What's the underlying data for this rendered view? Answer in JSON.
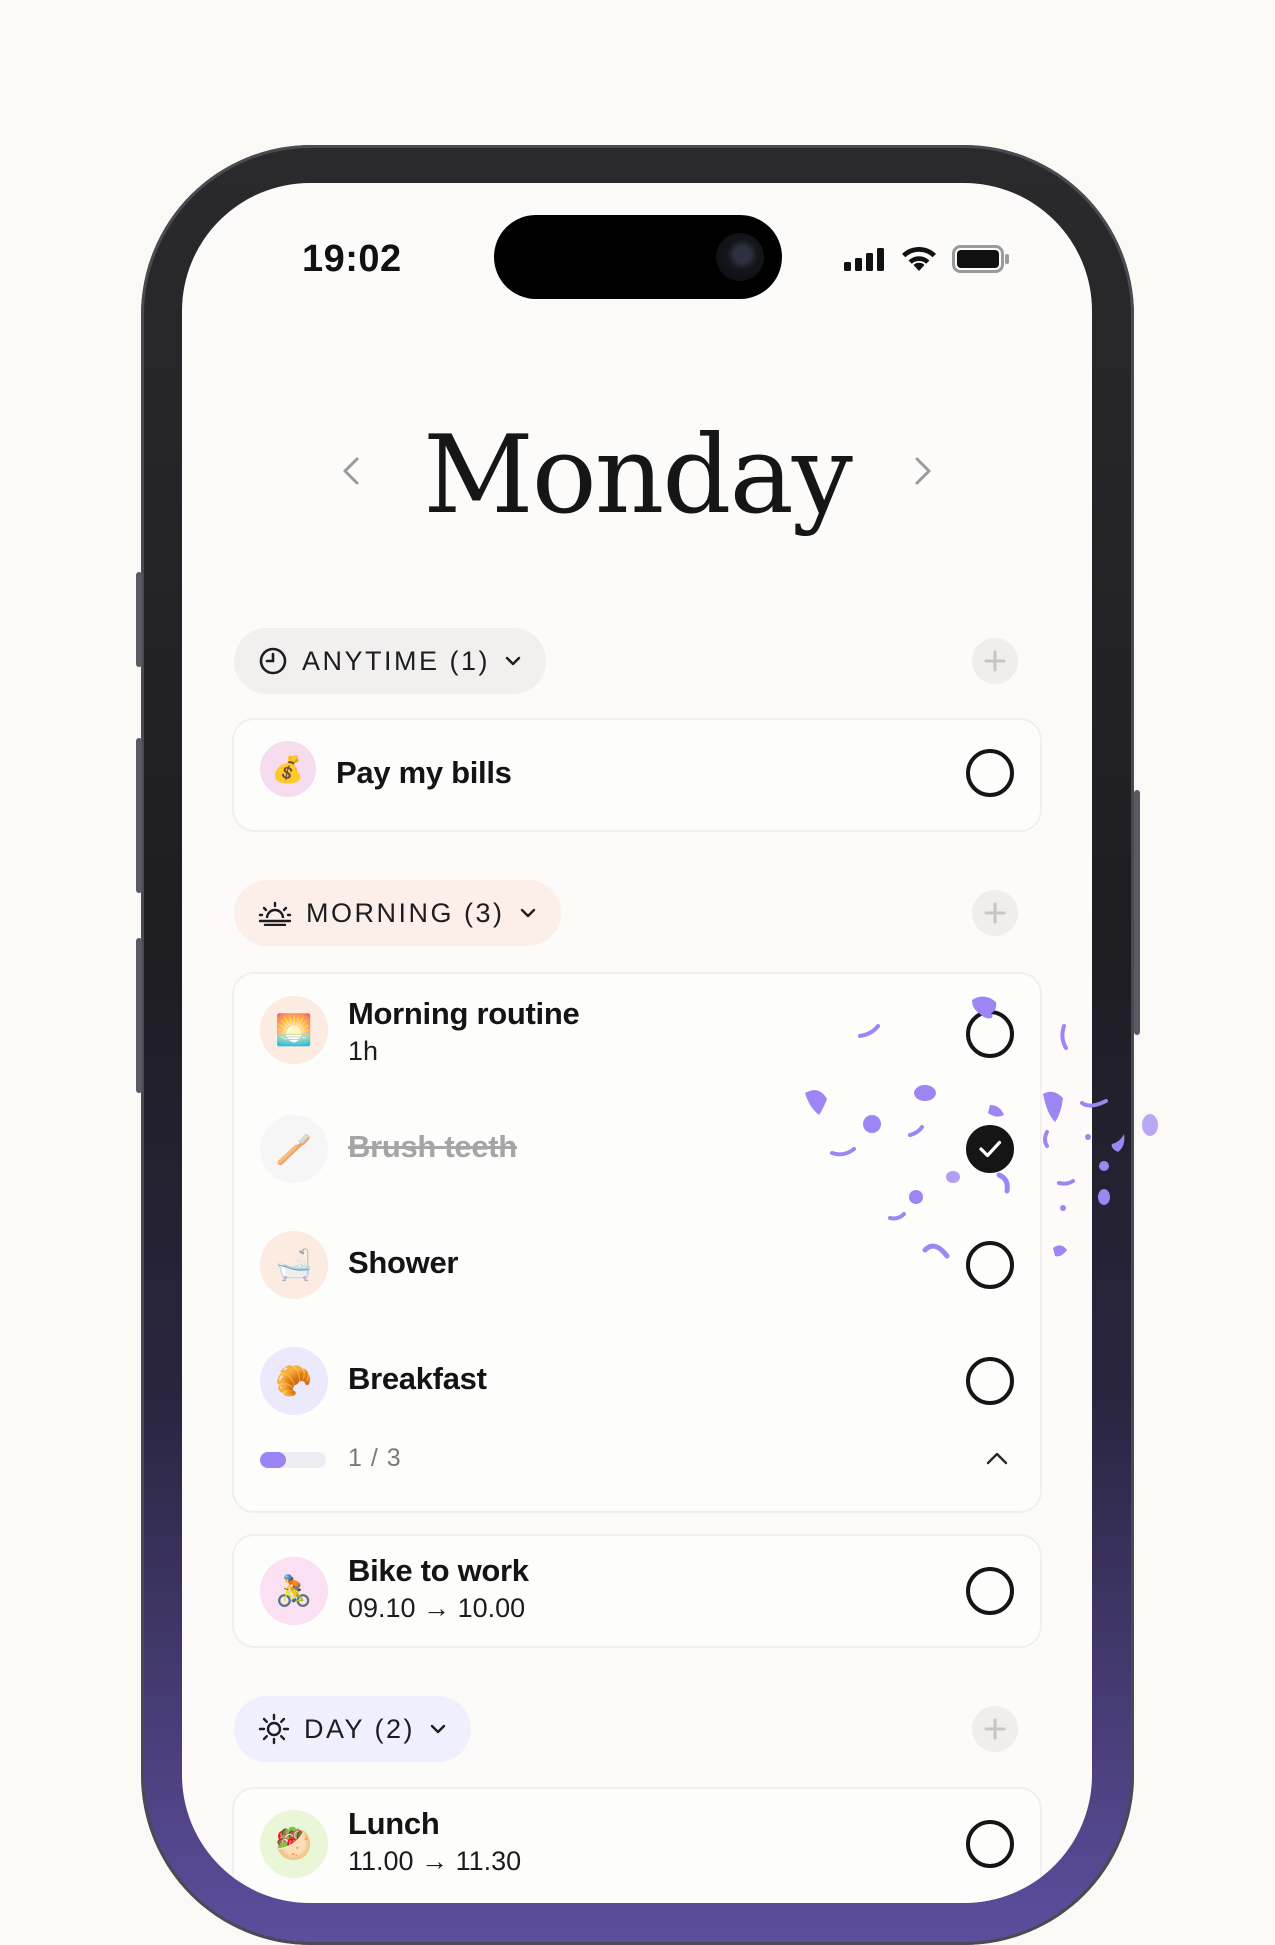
{
  "status_bar": {
    "time": "19:02"
  },
  "header": {
    "title": "Monday",
    "prev_icon": "chevron-left-icon",
    "next_icon": "chevron-right-icon"
  },
  "sections": {
    "anytime": {
      "label": "ANYTIME (1)",
      "icon": "clock-icon",
      "bg": "#f2f0ee"
    },
    "morning": {
      "label": "MORNING (3)",
      "icon": "sunrise-icon",
      "bg": "#fcefe9"
    },
    "day": {
      "label": "DAY (2)",
      "icon": "sun-icon",
      "bg": "#f0effd"
    }
  },
  "tasks": {
    "pay_bills": {
      "title": "Pay my bills",
      "emoji": "💰",
      "bg": "#f6dcef",
      "done": false
    },
    "morning_routine": {
      "title": "Morning routine",
      "subtitle": "1h",
      "emoji": "🌅",
      "bg": "#fbebe1",
      "subtasks": [
        {
          "title": "Brush teeth",
          "emoji": "🪥",
          "bg": "#f2f2f2",
          "done": true
        },
        {
          "title": "Shower",
          "emoji": "🛁",
          "bg": "#fbebe1",
          "done": false
        },
        {
          "title": "Breakfast",
          "emoji": "🥐",
          "bg": "#ebe9fb",
          "done": false
        }
      ],
      "progress_text": "1 / 3",
      "progress": 0.33
    },
    "bike": {
      "title": "Bike to work",
      "subtitle": "09.10 → 10.00",
      "emoji": "🚴",
      "bg": "#fae0f2",
      "done": false
    },
    "lunch": {
      "title": "Lunch",
      "subtitle": "11.00 → 11.30",
      "emoji": "🥙",
      "bg": "#eaf6d8",
      "done": false
    }
  },
  "colors": {
    "accent": "#9b85f5",
    "confetti": "#9d86f3",
    "text": "#151515"
  }
}
